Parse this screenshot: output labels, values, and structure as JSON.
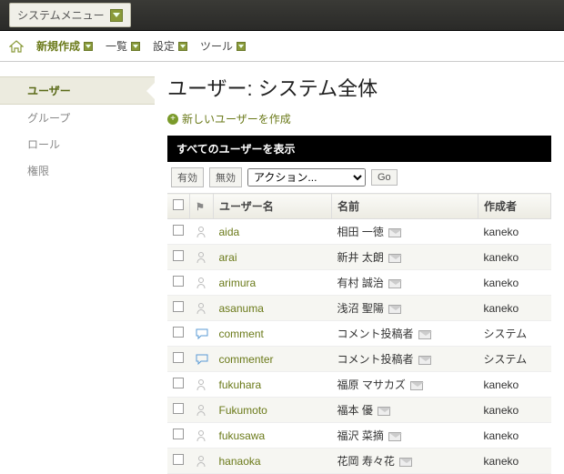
{
  "topbar": {
    "system_menu": "システムメニュー"
  },
  "nav": {
    "create": "新規作成",
    "list": "一覧",
    "settings": "設定",
    "tools": "ツール"
  },
  "sidebar": {
    "items": [
      {
        "label": "ユーザー",
        "active": true
      },
      {
        "label": "グループ"
      },
      {
        "label": "ロール"
      },
      {
        "label": "権限"
      }
    ]
  },
  "page": {
    "title": "ユーザー: システム全体",
    "create_link": "新しいユーザーを作成",
    "blackbar": "すべてのユーザーを表示"
  },
  "toolbar": {
    "enabled": "有効",
    "disabled": "無効",
    "action_placeholder": "アクション...",
    "go": "Go"
  },
  "table": {
    "headers": {
      "username": "ユーザー名",
      "name": "名前",
      "creator": "作成者"
    },
    "rows": [
      {
        "icon": "person",
        "username": "aida",
        "name": "相田 一徳",
        "creator": "kaneko"
      },
      {
        "icon": "person",
        "username": "arai",
        "name": "新井 太朗",
        "creator": "kaneko"
      },
      {
        "icon": "person",
        "username": "arimura",
        "name": "有村 誠治",
        "creator": "kaneko"
      },
      {
        "icon": "person",
        "username": "asanuma",
        "name": "浅沼 聖陽",
        "creator": "kaneko"
      },
      {
        "icon": "comment",
        "username": "comment",
        "name": "コメント投稿者",
        "creator": "システム"
      },
      {
        "icon": "comment",
        "username": "commenter",
        "name": "コメント投稿者",
        "creator": "システム"
      },
      {
        "icon": "person",
        "username": "fukuhara",
        "name": "福原 マサカズ",
        "creator": "kaneko"
      },
      {
        "icon": "person",
        "username": "Fukumoto",
        "name": "福本 優",
        "creator": "kaneko"
      },
      {
        "icon": "person",
        "username": "fukusawa",
        "name": "福沢 菜摘",
        "creator": "kaneko"
      },
      {
        "icon": "person",
        "username": "hanaoka",
        "name": "花岡 寿々花",
        "creator": "kaneko"
      }
    ]
  }
}
